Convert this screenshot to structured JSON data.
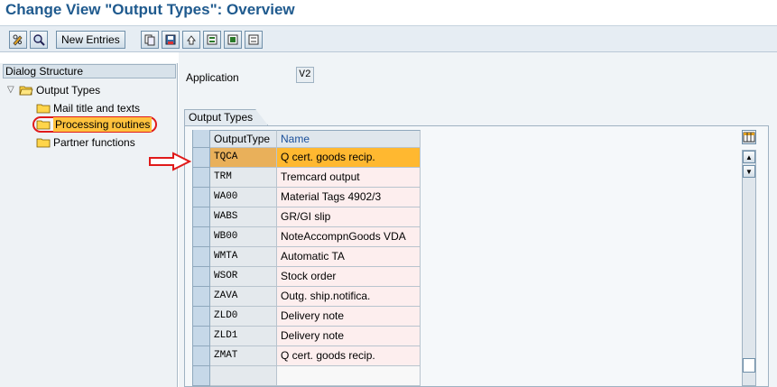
{
  "title": "Change View \"Output Types\": Overview",
  "toolbar": {
    "new_entries_label": "New Entries",
    "icons": [
      "pencil-glasses-icon",
      "details-icon",
      "copy-icon",
      "save-icon",
      "undo-icon",
      "select-all-icon",
      "select-block-icon",
      "deselect-all-icon"
    ]
  },
  "dialog_structure": {
    "header": "Dialog Structure",
    "root": "Output Types",
    "items": [
      {
        "label": "Mail title and texts"
      },
      {
        "label": "Processing routines"
      },
      {
        "label": "Partner functions"
      }
    ]
  },
  "application": {
    "label": "Application",
    "value": "V2"
  },
  "group": {
    "tab_label": "Output Types"
  },
  "table": {
    "columns": [
      "OutputType",
      "Name"
    ],
    "rows": [
      {
        "code": "TQCA",
        "name": "Q cert. goods recip."
      },
      {
        "code": "TRM",
        "name": "Tremcard output"
      },
      {
        "code": "WA00",
        "name": "Material Tags 4902/3"
      },
      {
        "code": "WABS",
        "name": "GR/GI slip"
      },
      {
        "code": "WB00",
        "name": "NoteAccompnGoods VDA"
      },
      {
        "code": "WMTA",
        "name": "Automatic TA"
      },
      {
        "code": "WSOR",
        "name": "Stock order"
      },
      {
        "code": "ZAVA",
        "name": "Outg. ship.notifica."
      },
      {
        "code": "ZLD0",
        "name": "Delivery note"
      },
      {
        "code": "ZLD1",
        "name": "Delivery note"
      },
      {
        "code": "ZMAT",
        "name": "Q cert. goods recip."
      }
    ]
  },
  "colors": {
    "title": "#1f5a8e",
    "highlight_row": "#ffb830",
    "annotation_red": "#e01a1a"
  }
}
